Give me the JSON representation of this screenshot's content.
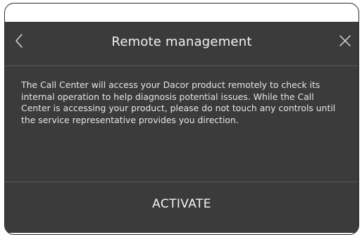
{
  "dialog": {
    "title": "Remote management",
    "back_icon": "chevron-left-icon",
    "close_icon": "close-icon",
    "message": "The Call Center will access your Dacor product remotely to check its internal operation to help diagnosis potential issues. While the Call Center is accessing your product, please do not touch any controls until the service representative provides you direction.",
    "activate_label": "ACTIVATE"
  },
  "colors": {
    "panel_background": "#3b3b3b",
    "text": "#f2f2f2",
    "divider": "#5a5a5a",
    "bezel": "#2a2a2a"
  }
}
